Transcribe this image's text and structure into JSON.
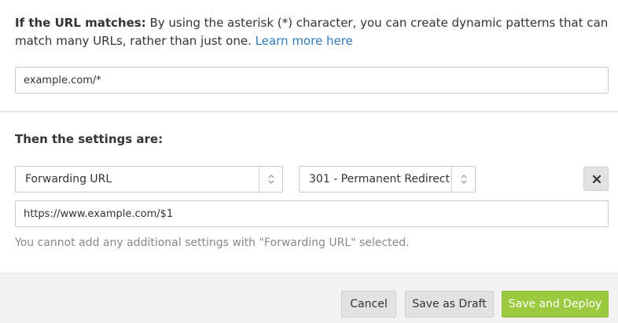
{
  "match_section": {
    "label": "If the URL matches:",
    "description": " By using the asterisk (*) character, you can create dynamic patterns that can match many URLs, rather than just one. ",
    "learn_more_link": "Learn more here",
    "url_pattern_value": "example.com/*"
  },
  "settings_section": {
    "title": "Then the settings are:",
    "setting_select": {
      "selected": "Forwarding URL"
    },
    "status_code_select": {
      "selected": "301 - Permanent Redirect"
    },
    "destination_url_value": "https://www.example.com/$1",
    "note": "You cannot add any additional settings with \"Forwarding URL\" selected.",
    "remove_icon": "close-icon"
  },
  "footer": {
    "cancel_label": "Cancel",
    "save_draft_label": "Save as Draft",
    "save_deploy_label": "Save and Deploy"
  },
  "colors": {
    "link": "#2f7bbf",
    "deploy_button": "#9bca3e",
    "footer_bg": "#f2f2f2"
  }
}
